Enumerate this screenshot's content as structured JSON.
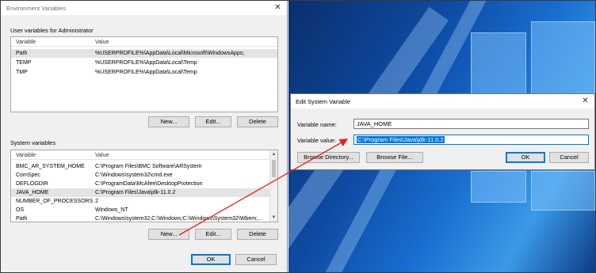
{
  "env_dialog": {
    "title": "Environment Variables",
    "close_glyph": "✕",
    "user_section_label": "User variables for Administrator",
    "system_section_label": "System variables",
    "columns": {
      "variable": "Variable",
      "value": "Value"
    },
    "user_vars": [
      {
        "variable": "Path",
        "value": "%USERPROFILE%\\AppData\\Local\\Microsoft\\WindowsApps;"
      },
      {
        "variable": "TEMP",
        "value": "%USERPROFILE%\\AppData\\Local\\Temp"
      },
      {
        "variable": "TMP",
        "value": "%USERPROFILE%\\AppData\\Local\\Temp"
      }
    ],
    "system_vars": [
      {
        "variable": "BMC_AR_SYSTEM_HOME",
        "value": "C:\\Program Files\\BMC Software\\ARSystem"
      },
      {
        "variable": "ComSpec",
        "value": "C:\\Windows\\system32\\cmd.exe"
      },
      {
        "variable": "DEFLOGDIR",
        "value": "C:\\ProgramData\\McAfee\\DesktopProtection"
      },
      {
        "variable": "JAVA_HOME",
        "value": "C:\\Program Files\\Java\\jdk-11.0.2"
      },
      {
        "variable": "NUMBER_OF_PROCESSORS",
        "value": "2"
      },
      {
        "variable": "OS",
        "value": "Windows_NT"
      },
      {
        "variable": "Path",
        "value": "C:\\Windows\\system32;C:\\Windows;C:\\Windows\\System32\\Wbem;..."
      }
    ],
    "selected_system_var_index": 3,
    "buttons": {
      "new": "New...",
      "edit": "Edit...",
      "delete": "Delete",
      "ok": "OK",
      "cancel": "Cancel"
    }
  },
  "edit_dialog": {
    "title": "Edit System Variable",
    "close_glyph": "✕",
    "name_label": "Variable name:",
    "name_value": "JAVA_HOME",
    "value_label": "Variable value:",
    "value_value": "C:\\Program Files\\Java\\jdk-11.0.2",
    "buttons": {
      "browse_directory": "Browse Directory...",
      "browse_file": "Browse File...",
      "ok": "OK",
      "cancel": "Cancel"
    }
  },
  "colors": {
    "annotation_arrow": "#e02020",
    "selection": "#0078d7",
    "dialog_bg": "#f0f0f0"
  }
}
